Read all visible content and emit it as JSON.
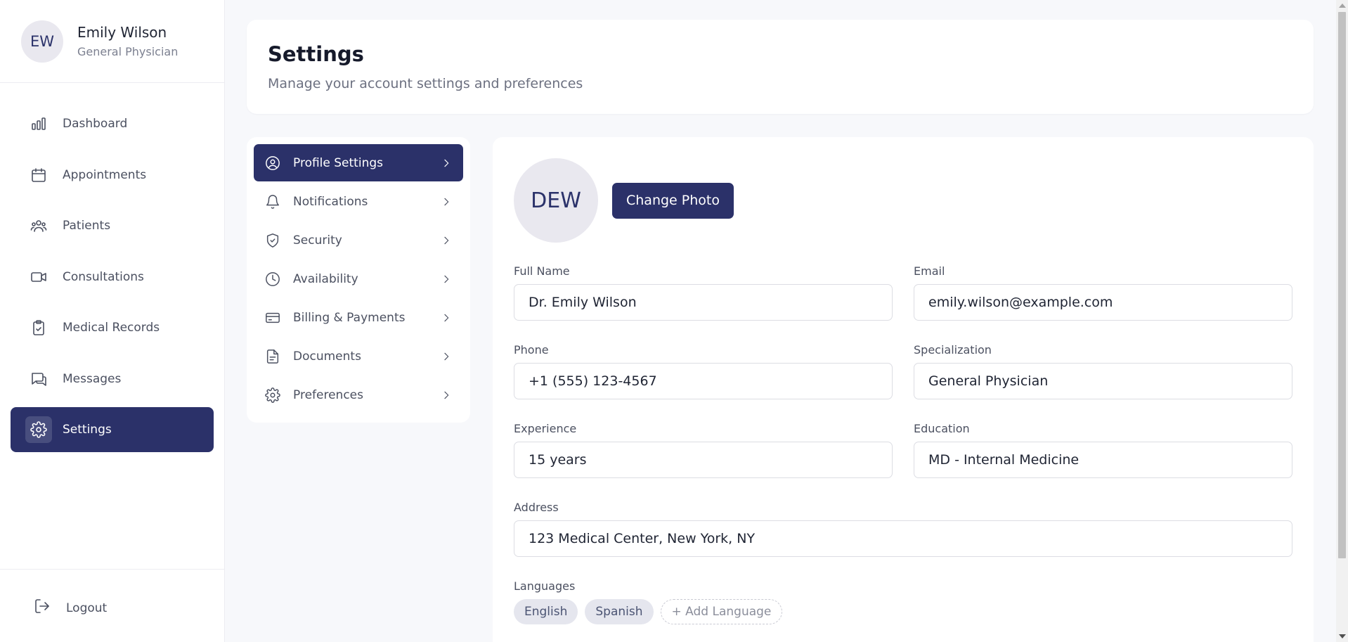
{
  "user": {
    "initials": "EW",
    "name": "Emily Wilson",
    "role": "General Physician"
  },
  "sidebar": {
    "items": [
      {
        "label": "Dashboard",
        "icon": "bar-chart-icon"
      },
      {
        "label": "Appointments",
        "icon": "calendar-icon"
      },
      {
        "label": "Patients",
        "icon": "users-icon"
      },
      {
        "label": "Consultations",
        "icon": "video-icon"
      },
      {
        "label": "Medical Records",
        "icon": "clipboard-icon"
      },
      {
        "label": "Messages",
        "icon": "messages-icon"
      },
      {
        "label": "Settings",
        "icon": "gear-icon",
        "active": true
      }
    ],
    "logout_label": "Logout"
  },
  "header": {
    "title": "Settings",
    "subtitle": "Manage your account settings and preferences"
  },
  "settings_menu": {
    "items": [
      {
        "label": "Profile Settings",
        "icon": "user-circle-icon",
        "active": true
      },
      {
        "label": "Notifications",
        "icon": "bell-icon"
      },
      {
        "label": "Security",
        "icon": "shield-check-icon"
      },
      {
        "label": "Availability",
        "icon": "clock-icon"
      },
      {
        "label": "Billing & Payments",
        "icon": "credit-card-icon"
      },
      {
        "label": "Documents",
        "icon": "file-icon"
      },
      {
        "label": "Preferences",
        "icon": "gear-icon"
      }
    ]
  },
  "profile_form": {
    "avatar_initials": "DEW",
    "change_photo_label": "Change Photo",
    "full_name": {
      "label": "Full Name",
      "value": "Dr. Emily Wilson"
    },
    "email": {
      "label": "Email",
      "value": "emily.wilson@example.com"
    },
    "phone": {
      "label": "Phone",
      "value": "+1 (555) 123-4567"
    },
    "specialization": {
      "label": "Specialization",
      "value": "General Physician"
    },
    "experience": {
      "label": "Experience",
      "value": "15 years"
    },
    "education": {
      "label": "Education",
      "value": "MD - Internal Medicine"
    },
    "address": {
      "label": "Address",
      "value": "123 Medical Center, New York, NY"
    },
    "languages": {
      "label": "Languages",
      "items": [
        "English",
        "Spanish"
      ],
      "add_label": "+ Add Language"
    }
  },
  "colors": {
    "primary": "#2b3169",
    "background": "#f7f8fb",
    "avatar_bg": "#e9e8ef"
  }
}
